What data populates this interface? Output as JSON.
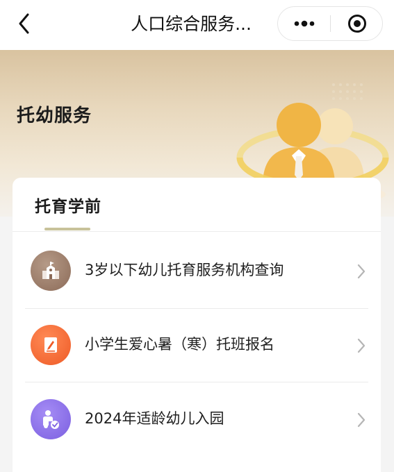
{
  "navbar": {
    "back_icon": "chevron-left-icon",
    "title": "人口综合服务...",
    "more_icon": "more-dots-icon",
    "close_icon": "target-close-icon"
  },
  "banner": {
    "title": "托幼服务",
    "colors": {
      "gradient_top": "#d9c3a0",
      "gradient_bottom": "#f4f1ec",
      "figure_front": "#f2b645",
      "figure_back": "#f5d99e"
    }
  },
  "card": {
    "tab_label": "托育学前",
    "underline_color": "#c8c29a",
    "items": [
      {
        "label": "3岁以下幼儿托育服务机构查询",
        "icon": "building-icon",
        "color": "#9a7a66"
      },
      {
        "label": "小学生爱心暑（寒）托班报名",
        "icon": "edit-form-icon",
        "color": "#f06a35"
      },
      {
        "label": "2024年适龄幼儿入园",
        "icon": "child-care-icon",
        "color": "#8a6fe8"
      }
    ]
  }
}
